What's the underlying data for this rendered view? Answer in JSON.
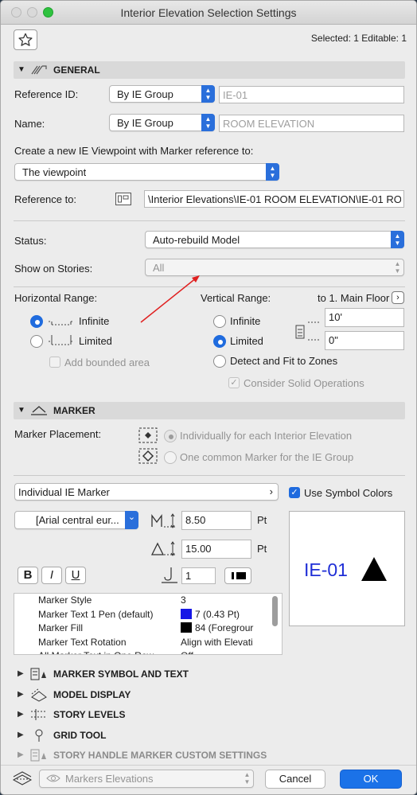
{
  "window": {
    "title": "Interior Elevation Selection Settings"
  },
  "header": {
    "selection_info": "Selected: 1 Editable: 1"
  },
  "general": {
    "section_title": "GENERAL",
    "reference_id_label": "Reference ID:",
    "reference_id_mode": "By IE Group",
    "reference_id_value": "IE-01",
    "name_label": "Name:",
    "name_mode": "By IE Group",
    "name_value": "ROOM ELEVATION",
    "create_label": "Create a new IE Viewpoint with Marker reference to:",
    "create_value": "The viewpoint",
    "reference_to_label": "Reference to:",
    "reference_to_value": "\\Interior Elevations\\IE-01 ROOM ELEVATION\\IE-01 ROO"
  },
  "status": {
    "status_label": "Status:",
    "status_value": "Auto-rebuild Model",
    "stories_label": "Show on Stories:",
    "stories_value": "All"
  },
  "range": {
    "horizontal_label": "Horizontal Range:",
    "infinite": "Infinite",
    "limited": "Limited",
    "add_bounded": "Add bounded area",
    "vertical_label": "Vertical Range:",
    "to_floor": "to 1. Main Floor",
    "v_infinite": "Infinite",
    "v_limited": "Limited",
    "top_value": "10'",
    "bottom_value": "0\"",
    "detect_fit": "Detect and Fit to Zones",
    "consider_solid": "Consider Solid Operations"
  },
  "marker": {
    "section_title": "MARKER",
    "placement_label": "Marker Placement:",
    "option_individual": "Individually for each Interior Elevation",
    "option_common": "One common Marker for the IE Group",
    "marker_type": "Individual IE Marker",
    "use_symbol_colors": "Use Symbol Colors",
    "font": "[Arial central eur...",
    "size1": "8.50",
    "size1_unit": "Pt",
    "size2": "15.00",
    "size2_unit": "Pt",
    "pen": "1",
    "bold": "B",
    "italic": "I",
    "underline": "U",
    "preview_text": "IE-01",
    "preview_color": "#1f2ed6"
  },
  "params": [
    {
      "name": "Marker Style",
      "value": "3",
      "swatch": ""
    },
    {
      "name": "Marker Text 1 Pen (default)",
      "value": "7 (0.43 Pt)",
      "swatch": "#1616e6"
    },
    {
      "name": "Marker Fill",
      "value": "84 (Foregrour",
      "swatch": "#000000"
    },
    {
      "name": "Marker Text Rotation",
      "value": "Align with Elevati",
      "swatch": ""
    },
    {
      "name": "All Marker Text in One Row",
      "value": "Off",
      "swatch": ""
    }
  ],
  "sections": [
    {
      "title": "MARKER SYMBOL AND TEXT",
      "disabled": false
    },
    {
      "title": "MODEL DISPLAY",
      "disabled": false
    },
    {
      "title": "STORY LEVELS",
      "disabled": false
    },
    {
      "title": "GRID TOOL",
      "disabled": false
    },
    {
      "title": "STORY HANDLE MARKER CUSTOM SETTINGS",
      "disabled": true
    }
  ],
  "footer": {
    "layer": "Markers Elevations",
    "cancel": "Cancel",
    "ok": "OK"
  },
  "colors": {
    "accent": "#1b72e8",
    "annotation_arrow": "#e02020"
  }
}
